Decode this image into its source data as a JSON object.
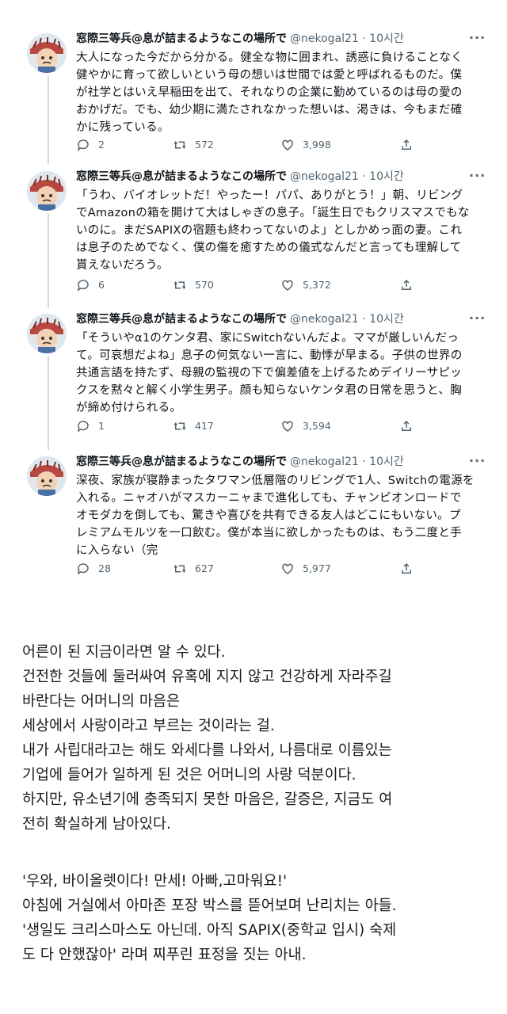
{
  "tweets": [
    {
      "name": "窓際三等兵@息が詰まるようなこの場所で",
      "handle": "@nekogal21 · 10시간",
      "lines": [
        "大人になった今だから分かる。健全な物に囲まれ、誘惑に負けることなく",
        "健やかに育って欲しいという母の想いは世間では愛と呼ばれるものだ。僕",
        "が社学とはいえ早稲田を出て、それなりの企業に勤めているのは母の愛の",
        "おかげだ。でも、幼少期に満たされなかった想いは、渇きは、今もまだ確",
        "かに残っている。"
      ],
      "replies": "2",
      "retweets": "572",
      "likes": "3,998"
    },
    {
      "name": "窓際三等兵@息が詰まるようなこの場所で",
      "handle": "@nekogal21 · 10시간",
      "lines": [
        "「うわ、バイオレットだ！やったー！パパ、ありがとう！」朝、リビング",
        "でAmazonの箱を開けて大はしゃぎの息子。「誕生日でもクリスマスでもな",
        "いのに。まだSAPIXの宿題も終わってないのよ」としかめっ面の妻。これ",
        "は息子のためでなく、僕の傷を癒すための儀式なんだと言っても理解して",
        "貰えないだろう。"
      ],
      "replies": "6",
      "retweets": "570",
      "likes": "5,372"
    },
    {
      "name": "窓際三等兵@息が詰まるようなこの場所で",
      "handle": "@nekogal21 · 10시간",
      "lines": [
        "「そういやα1のケンタ君、家にSwitchないんだよ。ママが厳しいんだっ",
        "て。可哀想だよね」息子の何気ない一言に、動悸が早まる。子供の世界の",
        "共通言語を持たず、母親の監視の下で偏差値を上げるためデイリーサピッ",
        "クスを黙々と解く小学生男子。顔も知らないケンタ君の日常を思うと、胸",
        "が締め付けられる。"
      ],
      "replies": "1",
      "retweets": "417",
      "likes": "3,594"
    },
    {
      "name": "窓際三等兵@息が詰まるようなこの場所で",
      "handle": "@nekogal21 · 10시간",
      "lines": [
        "深夜、家族が寝静まったタワマン低層階のリビングで1人、Switchの電源を",
        "入れる。ニャオハがマスカーニャまで進化しても、チャンピオンロードで",
        "オモダカを倒しても、驚きや喜びを共有できる友人はどこにもいない。プ",
        "レミアムモルツを一口飲む。僕が本当に欲しかったものは、もう二度と手",
        "に入らない（完"
      ],
      "replies": "28",
      "retweets": "627",
      "likes": "5,977"
    }
  ],
  "article": {
    "para1": [
      "어른이 된 지금이라면 알 수 있다.",
      "건전한 것들에 둘러싸여 유혹에 지지 않고 건강하게 자라주길",
      "바란다는 어머니의 마음은",
      "세상에서 사랑이라고 부르는 것이라는 걸.",
      "내가 사립대라고는 해도 와세다를 나와서, 나름대로 이름있는",
      "기업에 들어가 일하게 된 것은 어머니의 사랑 덕분이다.",
      "하지만, 유소년기에 충족되지 못한 마음은, 갈증은, 지금도 여",
      "전히 확실하게 남아있다."
    ],
    "para2": [
      "'우와, 바이올렛이다! 만세! 아빠,고마워요!'",
      "아침에 거실에서 아마존 포장 박스를 뜯어보며 난리치는 아들.",
      "'생일도 크리스마스도 아닌데. 아직 SAPIX(중학교 입시) 숙제",
      "도 다 안했잖아' 라며 찌푸린 표정을 짓는 아내."
    ]
  },
  "colors": {
    "muted": "#536471",
    "thread_line": "#cfd9de",
    "text": "#0f1419"
  },
  "icons": [
    "avatar-icon",
    "more-icon",
    "reply-icon",
    "retweet-icon",
    "like-icon",
    "share-icon"
  ]
}
